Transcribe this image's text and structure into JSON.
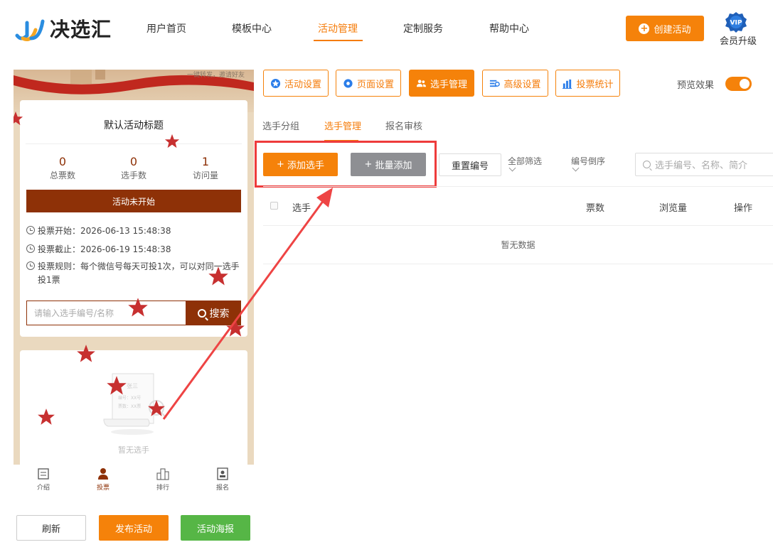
{
  "brand": {
    "name": "决选汇"
  },
  "nav": {
    "items": [
      {
        "label": "用户首页"
      },
      {
        "label": "模板中心"
      },
      {
        "label": "活动管理"
      },
      {
        "label": "定制服务"
      },
      {
        "label": "帮助中心"
      }
    ],
    "active": "活动管理",
    "create_label": "创建活动",
    "vip_badge": "VIP",
    "vip_label": "会员升级"
  },
  "preview": {
    "top_note": "一键转发，邀请好友",
    "title": "默认活动标题",
    "stats": [
      {
        "value": "0",
        "label": "总票数"
      },
      {
        "value": "0",
        "label": "选手数"
      },
      {
        "value": "1",
        "label": "访问量"
      }
    ],
    "status": "活动未开始",
    "vote_start": "投票开始：2026-06-13 15:48:38",
    "vote_end": "投票截止：2026-06-19 15:48:38",
    "vote_rule": "投票规则：每个微信号每天可投1次，可以对同一选手投1票",
    "search_placeholder": "请输入选手编号/名称",
    "search_button": "搜索",
    "empty_card_lines": [
      "张三",
      "编号：XX号",
      "票数：XX票"
    ],
    "empty_text": "暂无选手",
    "tabs": [
      {
        "label": "介绍"
      },
      {
        "label": "投票"
      },
      {
        "label": "排行"
      },
      {
        "label": "报名"
      }
    ]
  },
  "bottom_buttons": {
    "refresh": "刷新",
    "publish": "发布活动",
    "poster": "活动海报"
  },
  "settings_tabs": [
    {
      "label": "活动设置"
    },
    {
      "label": "页面设置"
    },
    {
      "label": "选手管理"
    },
    {
      "label": "高级设置"
    },
    {
      "label": "投票统计"
    }
  ],
  "preview_toggle": {
    "label": "预览效果",
    "on": true
  },
  "sub_tabs": [
    {
      "label": "选手分组"
    },
    {
      "label": "选手管理"
    },
    {
      "label": "报名审核"
    }
  ],
  "toolbar": {
    "add": "添加选手",
    "batch": "批量添加",
    "reset": "重置编号",
    "filter": "全部筛选",
    "sort": "编号倒序",
    "search_placeholder": "选手编号、名称、简介"
  },
  "table": {
    "columns": [
      "选手",
      "票数",
      "浏览量",
      "操作"
    ],
    "empty": "暂无数据"
  },
  "colors": {
    "accent": "#f5820a",
    "maroon": "#8e3107",
    "green": "#56b646",
    "highlight": "#ee3b3b"
  }
}
